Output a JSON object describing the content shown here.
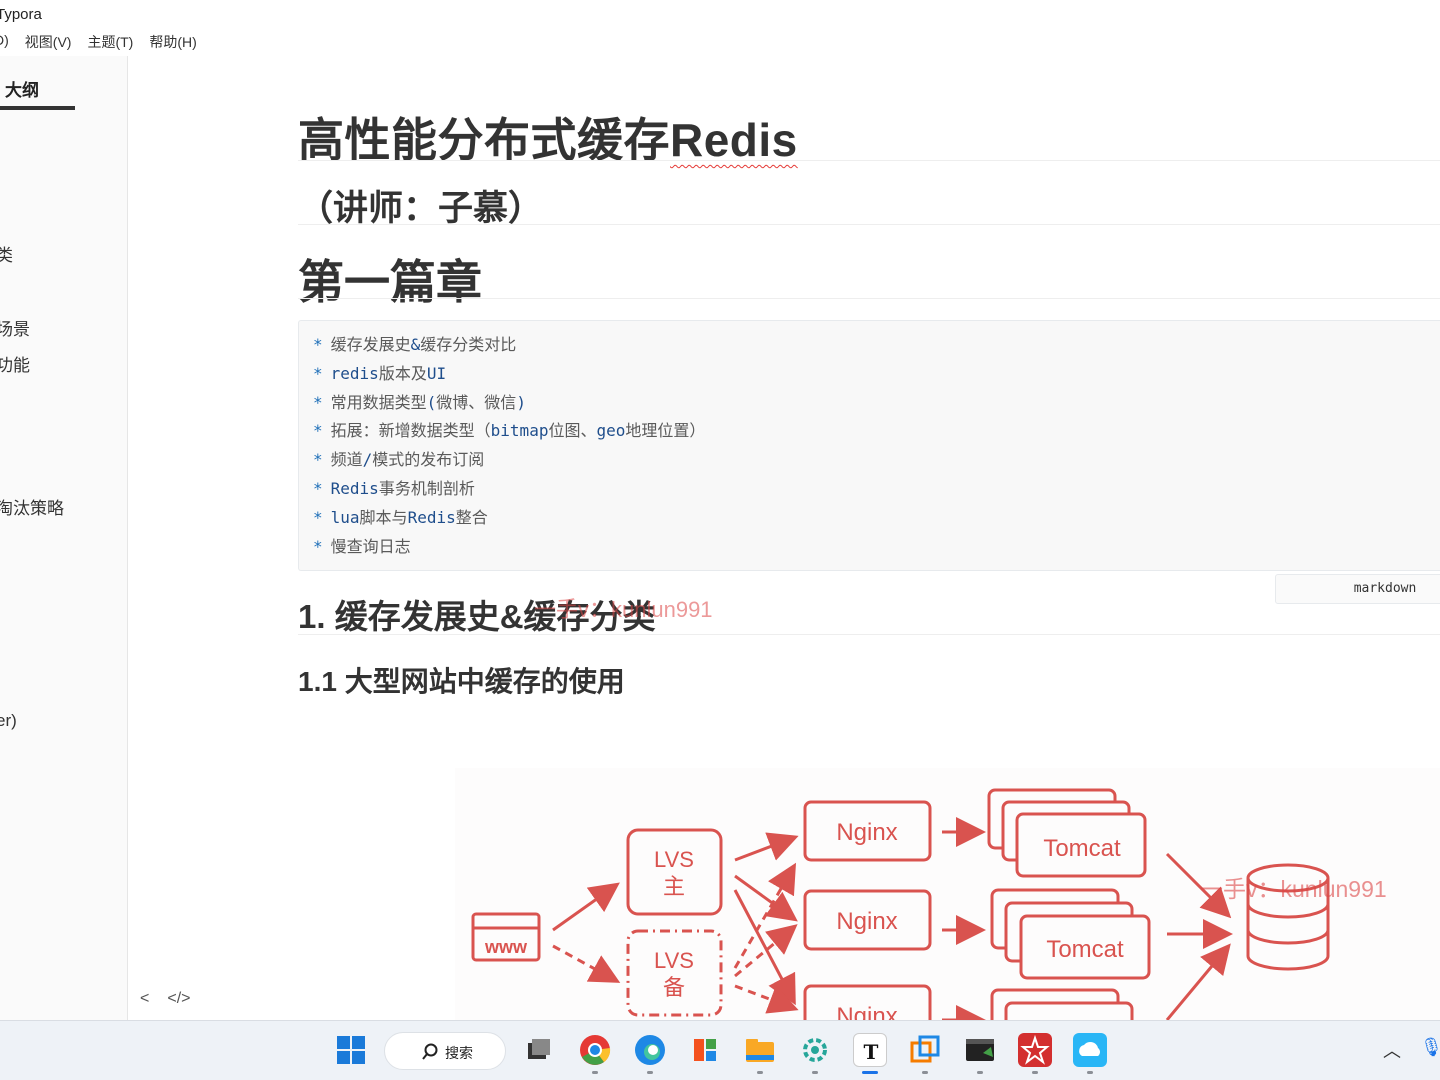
{
  "window": {
    "title": "Typora"
  },
  "menu": [
    "D)",
    "视图(V)",
    "主题(T)",
    "帮助(H)"
  ],
  "sidebar": {
    "tab_label": "大纲",
    "outline_items": [
      "类",
      "场景",
      "功能",
      "淘汰策略",
      "er)"
    ],
    "bottom_buttons": [
      "<",
      "</>"
    ]
  },
  "document": {
    "title_prefix": "高性能分布式缓存",
    "title_word": "Redis",
    "subtitle": "（讲师：子慕）",
    "chapter": "第一篇章",
    "code_lines": [
      [
        {
          "t": "缓存发展史",
          "c": "cn"
        },
        {
          "t": "&",
          "c": "kw"
        },
        {
          "t": "缓存分类对比",
          "c": "cn"
        }
      ],
      [
        {
          "t": "redis",
          "c": "kw"
        },
        {
          "t": "版本及",
          "c": "cn"
        },
        {
          "t": "UI",
          "c": "kw"
        }
      ],
      [
        {
          "t": "常用数据类型",
          "c": "cn"
        },
        {
          "t": "(",
          "c": "kw"
        },
        {
          "t": "微博、微信",
          "c": "cn"
        },
        {
          "t": ")",
          "c": "kw"
        }
      ],
      [
        {
          "t": "拓展：新增数据类型（",
          "c": "cn"
        },
        {
          "t": "bitmap",
          "c": "kw"
        },
        {
          "t": "位图、",
          "c": "cn"
        },
        {
          "t": "geo",
          "c": "kw"
        },
        {
          "t": "地理位置）",
          "c": "cn"
        }
      ],
      [
        {
          "t": "频道",
          "c": "cn"
        },
        {
          "t": "/",
          "c": "kw"
        },
        {
          "t": "模式的发布订阅",
          "c": "cn"
        }
      ],
      [
        {
          "t": "Redis",
          "c": "kw"
        },
        {
          "t": "事务机制剖析",
          "c": "cn"
        }
      ],
      [
        {
          "t": "lua",
          "c": "kw"
        },
        {
          "t": "脚本与",
          "c": "cn"
        },
        {
          "t": "Redis",
          "c": "kw"
        },
        {
          "t": "整合",
          "c": "cn"
        }
      ],
      [
        {
          "t": "慢查询日志",
          "c": "cn"
        }
      ]
    ],
    "code_bullet": "*",
    "code_lang": "markdown",
    "h2": "1. 缓存发展史&缓存分类",
    "h3": "1.1 大型网站中缓存的使用",
    "watermark_1": "一手v：kunlun991",
    "watermark_2": "一手v：kunlun991"
  },
  "diagram": {
    "www_label": "www",
    "lvs_master": [
      "LVS",
      "主"
    ],
    "lvs_backup": [
      "LVS",
      "备"
    ],
    "nginx": [
      "Nginx",
      "Nginx",
      "Nginx"
    ],
    "tomcat": [
      "Tomcat",
      "Tomcat"
    ],
    "accent_color": "#d9534f"
  },
  "taskbar": {
    "search_label": "搜索",
    "apps": [
      "start-icon",
      "task-view-icon",
      "chrome-icon",
      "edge-icon",
      "store-icon",
      "file-explorer-icon",
      "gear-app-icon",
      "typora-icon",
      "vmware-icon",
      "terminal-icon",
      "wps-icon",
      "cloud-icon"
    ]
  }
}
